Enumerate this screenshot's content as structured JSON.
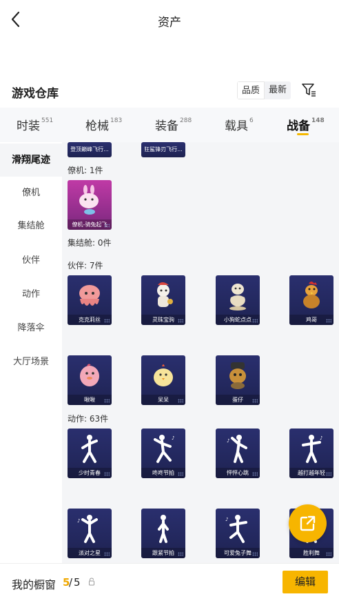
{
  "header": {
    "title": "资产"
  },
  "warehouse": {
    "title": "游戏仓库",
    "sort_options": [
      "品质",
      "最新"
    ]
  },
  "tabs": [
    {
      "label": "时装",
      "count": "551"
    },
    {
      "label": "枪械",
      "count": "183"
    },
    {
      "label": "装备",
      "count": "288"
    },
    {
      "label": "载具",
      "count": "6"
    },
    {
      "label": "战备",
      "count": "148"
    }
  ],
  "sidebar": [
    "滑翔尾迹",
    "僚机",
    "集结舱",
    "伙伴",
    "动作",
    "降落伞",
    "大厅场景"
  ],
  "groups": {
    "top_items": [
      "登顶巅峰飞行...",
      "狂鲨锋刃飞行..."
    ],
    "wingman_label": "僚机: 1件",
    "wingman_items": [
      "僚机-骑兔起飞"
    ],
    "capsule_label": "集结舱: 0件",
    "partner_label": "伙伴: 7件",
    "partner_items": [
      "克克莉丝",
      "灵珠宝驹",
      "小狗蛇点点",
      "鸡哥",
      "啾啾",
      "呆呆",
      "蛋仔"
    ],
    "emote_label": "动作: 63件",
    "emote_items": [
      "少时青春",
      "咚咚节拍",
      "怦怦心跳",
      "越打越年轻",
      "派对之星",
      "跟紧节拍",
      "可爱兔子舞",
      "胜利舞"
    ]
  },
  "footer": {
    "label": "我的橱窗",
    "current": "5",
    "separator": "/",
    "max": "5",
    "edit_label": "编辑"
  },
  "colors": {
    "accent": "#f7b500",
    "card_bg": "#262b63",
    "card_pink": "#b8359f"
  }
}
